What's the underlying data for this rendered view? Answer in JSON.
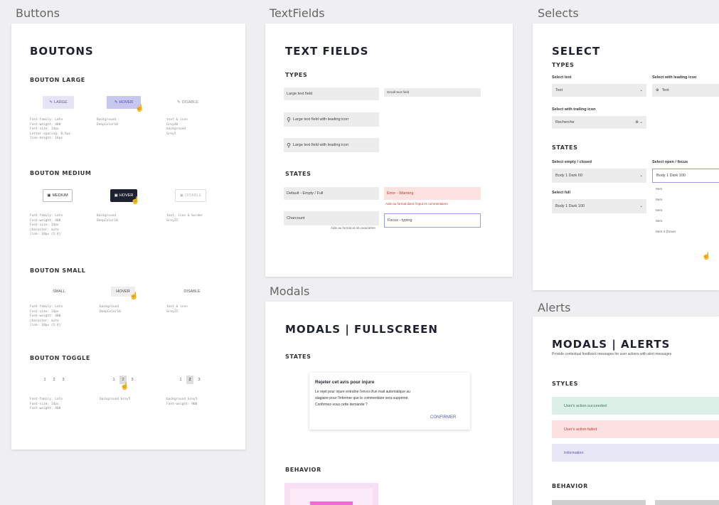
{
  "frames": {
    "buttons": "Buttons",
    "textfields": "TextFields",
    "selects": "Selects",
    "modals": "Modals",
    "alerts": "Alerts"
  },
  "buttons_card": {
    "title": "BOUTONS",
    "large": {
      "heading": "BOUTON LARGE",
      "btn_large": "LARGE",
      "btn_hover": "HOVER",
      "btn_disable": "DISABLE",
      "spec_1": "Font-family: Lato\nFont-weight: 400\nFont-size: 14px\nLetter-spacing: 0.5px\nline-height: 16px",
      "spec_2": "Background :\nDeepColor10",
      "spec_3": "text & icon\nGrey40\nbackground\nGrey5"
    },
    "medium": {
      "heading": "BOUTON MEDIUM",
      "btn_medium": "MEDIUM",
      "btn_hover": "HOVER",
      "btn_disable": "DISABLE",
      "spec_1": "Font-family: Lato\nFont-weight: 400\nFont-size: 14px\ncharacter: auto\nline: 18px (1.4)",
      "spec_2": "Background\nDeepColor10",
      "spec_3": "text, icon & border\nGrey25"
    },
    "small": {
      "heading": "BOUTON SMALL",
      "btn_small": "SMALL",
      "btn_hover": "HOVER",
      "btn_disable": "DISABLE",
      "spec_1": "Font-family: Lato\nFont-size: 14px\nFont-weight: 400\ncharacter: auto\nline: 18px (1.4)",
      "spec_2": "background\nDeepColor10",
      "spec_3": "text & icon\nGrey25"
    },
    "toggle": {
      "heading": "BOUTON TOGGLE",
      "items": [
        "1",
        "2",
        "3"
      ],
      "spec_1": "Font-family: Lato\nFont-size: 14px\nFont-weight: 400",
      "spec_2": "background Grey5",
      "spec_3": "background Grey5\nFont-weight: 900"
    }
  },
  "textfields_card": {
    "title": "TEXT FIELDS",
    "types_heading": "TYPES",
    "large_field": "Large text field",
    "small_field": "Small text field",
    "leading_icon_1": "Large text field with leading icon",
    "leading_icon_2": "Large text field with leading icon",
    "states_heading": "STATES",
    "default_state": "Default - Empty / Full",
    "error_state": "Error - Warning",
    "error_help": "Aide au format dans l'input et commentaires",
    "charcount_state": "Charcount",
    "charcount_help": "Aide au format et nb caractères",
    "focus_state": "Focus - typing"
  },
  "selects_card": {
    "title": "SELECT",
    "types_heading": "TYPES",
    "select_text_label": "Select text",
    "select_text_value": "Text",
    "select_icon_label": "Select with leading icon",
    "select_icon_value": "Text",
    "trailing_label": "Select with trailing icon",
    "trailing_value": "Recherche",
    "states_heading": "STATES",
    "empty_label": "Select empty / closed",
    "empty_value": "Body 1 Dark 60",
    "open_label": "Select open / focus",
    "open_value": "Body 1 Dark 100",
    "full_label": "Select full",
    "full_value": "Body 1 Dark 100",
    "options": [
      "Item",
      "Item",
      "Item",
      "Item",
      "Item 4 (hover"
    ]
  },
  "modals_card": {
    "title": "MODALS | FULLSCREEN",
    "states_heading": "STATES",
    "dialog_title": "Rejeter cet avis pour injure",
    "dialog_body_1": "Le rejet pour injure entraîne l'envoi d'un mail automatique au",
    "dialog_body_2": "stagiaire pour l'informer que le commentaire sera supprimé.",
    "dialog_body_3": "Confirmez-vous cette demande ?",
    "dialog_confirm": "CONFIRMER",
    "behavior_heading": "BEHAVIOR"
  },
  "alerts_card": {
    "title": "MODALS | ALERTS",
    "subtitle": "Provide contextual feedback messages for user actions with alert messages",
    "styles_heading": "STYLES",
    "alert_success": "User's action succeeded",
    "alert_error": "User's action failed",
    "alert_info": "Information",
    "behavior_heading": "BEHAVIOR"
  },
  "colors": {
    "success_bg": "#dcefe6",
    "error_bg": "#fbe1e1",
    "info_bg": "#e6e6f6",
    "accent": "#5a5ab0",
    "dark": "#1e2230",
    "pink": "#f06bd4"
  }
}
